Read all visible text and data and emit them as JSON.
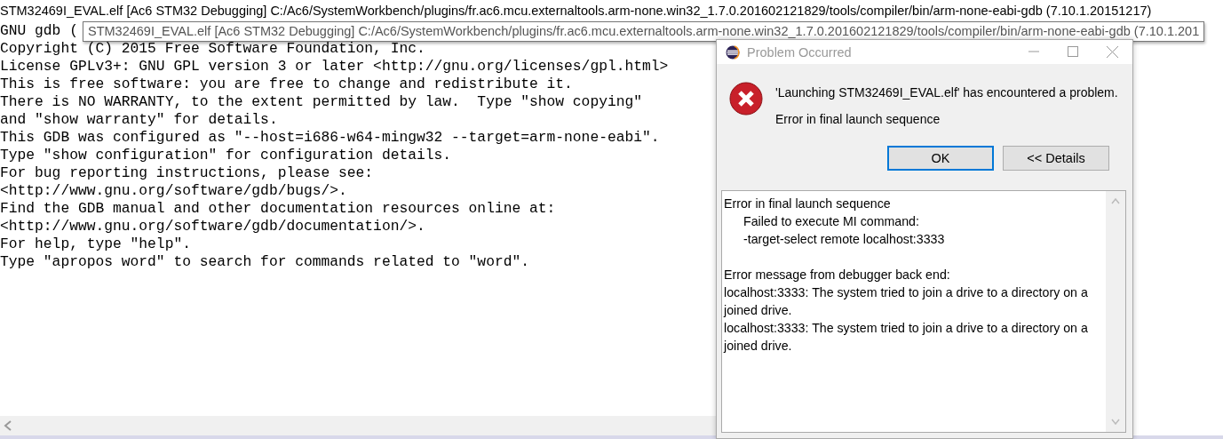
{
  "console": {
    "title": "STM32469I_EVAL.elf [Ac6 STM32 Debugging] C:/Ac6/SystemWorkbench/plugins/fr.ac6.mcu.externaltools.arm-none.win32_1.7.0.201602121829/tools/compiler/bin/arm-none-eabi-gdb (7.10.1.20151217)",
    "lines": [
      "GNU gdb (",
      "Copyright (C) 2015 Free Software Foundation, Inc.",
      "License GPLv3+: GNU GPL version 3 or later <http://gnu.org/licenses/gpl.html>",
      "This is free software: you are free to change and redistribute it.",
      "There is NO WARRANTY, to the extent permitted by law.  Type \"show copying\"",
      "and \"show warranty\" for details.",
      "This GDB was configured as \"--host=i686-w64-mingw32 --target=arm-none-eabi\".",
      "Type \"show configuration\" for configuration details.",
      "For bug reporting instructions, please see:",
      "<http://www.gnu.org/software/gdb/bugs/>.",
      "Find the GDB manual and other documentation resources online at:",
      "<http://www.gnu.org/software/gdb/documentation/>.",
      "For help, type \"help\".",
      "Type \"apropos word\" to search for commands related to \"word\"."
    ],
    "tooltip": "STM32469I_EVAL.elf [Ac6 STM32 Debugging] C:/Ac6/SystemWorkbench/plugins/fr.ac6.mcu.externaltools.arm-none.win32_1.7.0.201602121829/tools/compiler/bin/arm-none-eabi-gdb (7.10.1.201"
  },
  "dialog": {
    "title": "Problem Occurred",
    "message": "'Launching STM32469I_EVAL.elf' has encountered a problem.",
    "reason": "Error in final launch sequence",
    "buttons": [
      {
        "label": "OK",
        "default": true
      },
      {
        "label": "<< Details",
        "default": false
      }
    ],
    "details": "Error in final launch sequence\n\tFailed to execute MI command:\n\t-target-select remote localhost:3333\n\nError message from debugger back end:\nlocalhost:3333: The system tried to join a drive to a directory on a joined drive.\nlocalhost:3333: The system tried to join a drive to a directory on a joined drive."
  }
}
